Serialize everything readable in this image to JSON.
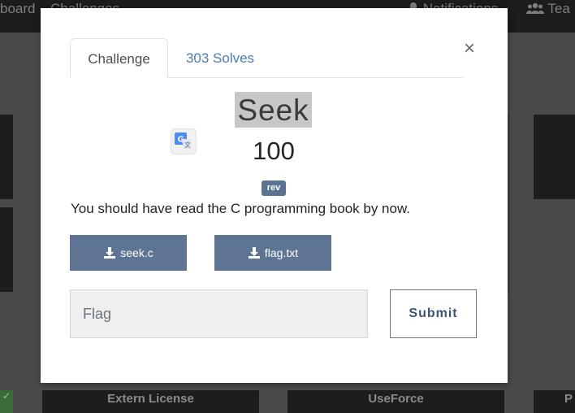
{
  "navbar": {
    "scoreboard_label": "board",
    "challenges_label": "Challenges",
    "notifications_label": "Notifications",
    "team_label": "Tea"
  },
  "background_cards": [
    {
      "label": ""
    },
    {
      "label": ""
    },
    {
      "label": ""
    },
    {
      "label": "Extern License"
    },
    {
      "label": "UseForce"
    },
    {
      "label": "P"
    }
  ],
  "modal": {
    "tabs": [
      {
        "label": "Challenge"
      },
      {
        "label": "303 Solves"
      }
    ],
    "close_label": "×",
    "challenge_name": "Seek",
    "challenge_value": "100",
    "category_tag": "rev",
    "description": "You should have read the C programming book by now.",
    "files": [
      {
        "name": "seek.c",
        "icon": "download-icon"
      },
      {
        "name": "flag.txt",
        "icon": "download-icon"
      }
    ],
    "flag_input": {
      "placeholder": "Flag",
      "value": ""
    },
    "submit_label": "Submit"
  }
}
